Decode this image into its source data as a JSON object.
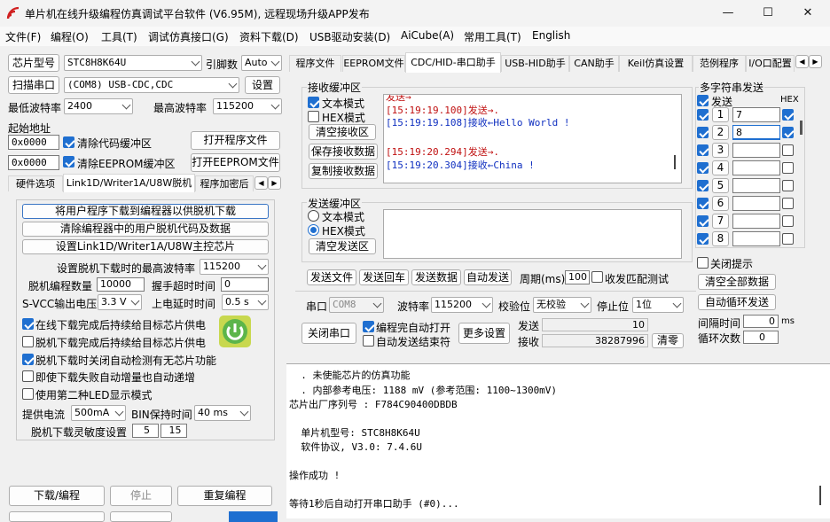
{
  "window": {
    "title": "单片机在线升级编程仿真调试平台软件 (V6.95M), 远程现场升级APP发布",
    "minimize": "—",
    "maximize": "☐",
    "close": "✕"
  },
  "menu": [
    "文件(F)",
    "编程(O)",
    "工具(T)",
    "调试仿真接口(G)",
    "资料下载(D)",
    "USB驱动安装(D)",
    "AiCube(A)",
    "常用工具(T)",
    "English"
  ],
  "left": {
    "chip_btn": "芯片型号",
    "chip_val": "STC8H8K64U",
    "freq_label": "引脚数",
    "pin_val": "Auto",
    "scan_btn": "扫描串口",
    "port_val": "(COM8) USB-CDC,CDC",
    "settings_btn": "设置",
    "min_baud_label": "最低波特率",
    "min_baud_val": "2400",
    "max_baud_label": "最高波特率",
    "max_baud_val": "115200",
    "start_addr_label": "起始地址",
    "addr1": "0x0000",
    "clear_code_label": "清除代码缓冲区",
    "open_prog_btn": "打开程序文件",
    "addr2": "0x0000",
    "clear_eeprom_label": "清除EEPROM缓冲区",
    "open_eeprom_btn": "打开EEPROM文件",
    "tabs": [
      "硬件选项",
      "Link1D/Writer1A/U8W脱机",
      "程序加密后"
    ],
    "btn_dl_offline": "将用户程序下载到编程器以供脱机下载",
    "btn_clear_offline": "清除编程器中的用户脱机代码及数据",
    "btn_set_master": "设置Link1D/Writer1A/U8W主控芯片",
    "max_baud_offline_label": "设置脱机下载时的最高波特率",
    "max_baud_offline_val": "115200",
    "offline_count_label": "脱机编程数量",
    "offline_count_val": "10000",
    "handshake_label": "握手超时时间",
    "handshake_val": "0",
    "svcc_label": "S-VCC输出电压",
    "svcc_val": "3.3 V",
    "poweron_label": "上电延时时间",
    "poweron_val": "0.5 s",
    "opt1": "在线下载完成后持续给目标芯片供电",
    "opt2": "脱机下载完成后持续给目标芯片供电",
    "opt3": "脱机下载时关闭自动检测有无芯片功能",
    "opt4": "即使下载失败自动增量也自动递增",
    "opt5": "使用第二种LED显示模式",
    "current_label": "提供电流",
    "current_val": "500mA",
    "bin_label": "BIN保持时间",
    "bin_val": "40 ms",
    "sens_label": "脱机下载灵敏度设置",
    "sens1": "5",
    "sens2": "15",
    "btn_download": "下载/编程",
    "btn_stop": "停止",
    "btn_reprog": "重复编程"
  },
  "right": {
    "tabs": [
      "程序文件",
      "EEPROM文件",
      "CDC/HID-串口助手",
      "USB-HID助手",
      "CAN助手",
      "Keil仿真设置",
      "范例程序",
      "I/O口配置"
    ],
    "rx_group": "接收缓冲区",
    "rx_text_mode": "文本模式",
    "rx_hex_mode": "HEX模式",
    "rx_clear": "清空接收区",
    "rx_save": "保存接收数据",
    "rx_copy": "复制接收数据",
    "rx_lines": [
      {
        "ts": "[15:19:19.100]",
        "dir": "发送→",
        "msg": "."
      },
      {
        "ts": "[15:19:19.108]",
        "dir": "接收←",
        "msg": "Hello World !"
      },
      {
        "ts": "[15:19:20.294]",
        "dir": "发送→",
        "msg": "."
      },
      {
        "ts": "[15:19:20.304]",
        "dir": "接收←",
        "msg": "China !"
      }
    ],
    "tx_group": "发送缓冲区",
    "tx_text_mode": "文本模式",
    "tx_hex_mode": "HEX模式",
    "tx_clear": "清空发送区",
    "btn_send_file": "发送文件",
    "btn_send_cr": "发送回车",
    "btn_send_data": "发送数据",
    "btn_auto_send": "自动发送",
    "period_label": "周期(ms)",
    "period_val": "100",
    "match_label": "收发匹配测试",
    "port_label": "串口",
    "port_val": "COM8",
    "baud_label": "波特率",
    "baud_val": "115200",
    "parity_label": "校验位",
    "parity_val": "无校验",
    "stop_label": "停止位",
    "stop_val": "1位",
    "btn_close_port": "关闭串口",
    "prog_open_label": "编程完自动打开",
    "auto_end_label": "自动发送结束符",
    "btn_more": "更多设置",
    "send_label": "发送",
    "send_count": "10",
    "recv_label": "接收",
    "recv_count": "38287996",
    "btn_clear_count": "清零",
    "multi_group": "多字符串发送",
    "multi_send": "发送",
    "multi_hex": "HEX",
    "multi_rows": [
      {
        "n": "1",
        "v": "7"
      },
      {
        "n": "2",
        "v": "8"
      },
      {
        "n": "3",
        "v": ""
      },
      {
        "n": "4",
        "v": ""
      },
      {
        "n": "5",
        "v": ""
      },
      {
        "n": "6",
        "v": ""
      },
      {
        "n": "7",
        "v": ""
      },
      {
        "n": "8",
        "v": ""
      }
    ],
    "close_tip": "关闭提示",
    "btn_clear_all": "清空全部数据",
    "btn_auto_loop": "自动循环发送",
    "interval_label": "间隔时间",
    "interval_val": "0",
    "interval_unit": "ms",
    "loop_label": "循环次数",
    "loop_val": "0"
  },
  "log": [
    "  . 未使能芯片的仿真功能",
    "  . 内部参考电压: 1188 mV (参考范围: 1100~1300mV)",
    "芯片出厂序列号 : F784C90400DBDB",
    "",
    "  单片机型号: STC8H8K64U",
    "  软件协议, V3.0: 7.4.6U",
    "",
    "操作成功 !",
    "",
    "等待1秒后自动打开串口助手 (#0)..."
  ]
}
